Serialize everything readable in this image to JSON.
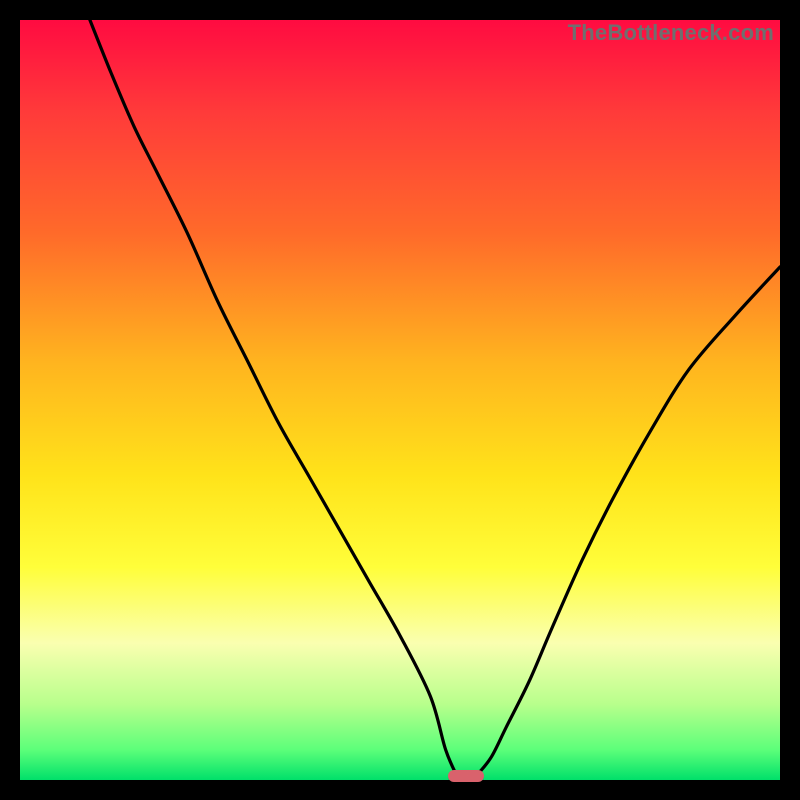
{
  "attribution": "TheBottleneck.com",
  "colors": {
    "frame": "#000000",
    "gradient_top": "#ff0b41",
    "gradient_bottom": "#00e06a",
    "curve": "#000000",
    "marker": "#d9626c",
    "attribution_text": "#6f6f6f"
  },
  "chart_data": {
    "type": "line",
    "title": "",
    "xlabel": "",
    "ylabel": "",
    "xlim": [
      0,
      100
    ],
    "ylim": [
      0,
      100
    ],
    "curve_left": {
      "x": [
        9.2,
        12,
        15,
        18,
        22,
        26,
        30,
        34,
        38,
        42,
        46,
        50,
        54,
        56,
        57.5
      ],
      "y": [
        100,
        93,
        86,
        80,
        72,
        63,
        55,
        47,
        40,
        33,
        26,
        19,
        11,
        4,
        0.5
      ]
    },
    "curve_right": {
      "x": [
        60,
        62,
        64,
        67,
        70,
        74,
        78,
        83,
        88,
        94,
        100
      ],
      "y": [
        0.5,
        3,
        7,
        13,
        20,
        29,
        37,
        46,
        54,
        61,
        67.5
      ]
    },
    "vertex": {
      "x": 58.7,
      "y": 0
    },
    "marker": {
      "x": 58.7,
      "y": 0.5,
      "width": 4.7,
      "height": 1.6
    }
  }
}
